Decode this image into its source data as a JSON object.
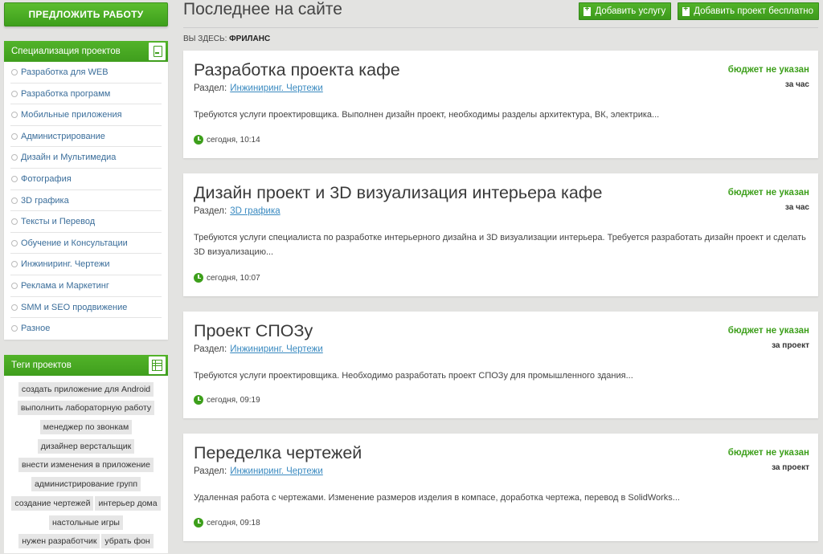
{
  "sidebar": {
    "offer_button": "ПРЕДЛОЖИТЬ РАБОТУ",
    "specs_title": "Специализация проектов",
    "specs": [
      "Разработка для WEB",
      "Разработка программ",
      "Мобильные приложения",
      "Администрирование",
      "Дизайн и Мультимедиа",
      "Фотография",
      "3D графика",
      "Тексты и Перевод",
      "Обучение и Консультации",
      "Инжиниринг. Чертежи",
      "Реклама и Маркетинг",
      "SMM и SEO продвижение",
      "Разное"
    ],
    "tags_title": "Теги проектов",
    "tags": [
      "создать приложение для Android",
      "выполнить лабораторную работу",
      "менеджер по звонкам",
      "дизайнер верстальщик",
      "внести изменения в приложение",
      "администрирование групп",
      "создание чертежей",
      "интерьер дома",
      "настольные игры",
      "нужен разработчик",
      "убрать фон"
    ]
  },
  "header": {
    "title": "Последнее на сайте",
    "add_service": "Добавить услугу",
    "add_project": "Добавить проект бесплатно",
    "crumbs_prefix": "ВЫ ЗДЕСЬ:",
    "crumbs_current": "ФРИЛАНС"
  },
  "projects": [
    {
      "title": "Разработка проекта кафе",
      "section_label": "Раздел:",
      "section": "Инжиниринг. Чертежи",
      "description": "Требуются услуги проектировщика. Выполнен дизайн проект, необходимы разделы архитектура, ВК, электрика...",
      "time": "сегодня, 10:14",
      "budget": "бюджет не указан",
      "per": "за час"
    },
    {
      "title": "Дизайн проект и 3D визуализация интерьера кафе",
      "section_label": "Раздел:",
      "section": "3D графика",
      "description": "Требуются услуги специалиста по разработке интерьерного дизайна и 3D визуализации интерьера. Требуется разработать дизайн проект и сделать 3D визуализацию...",
      "time": "сегодня, 10:07",
      "budget": "бюджет не указан",
      "per": "за час"
    },
    {
      "title": "Проект СПОЗу",
      "section_label": "Раздел:",
      "section": "Инжиниринг. Чертежи",
      "description": "Требуются услуги проектировщика. Необходимо разработать проект СПОЗу для промышленного здания...",
      "time": "сегодня, 09:19",
      "budget": "бюджет не указан",
      "per": "за проект"
    },
    {
      "title": "Переделка чертежей",
      "section_label": "Раздел:",
      "section": "Инжиниринг. Чертежи",
      "description": "Удаленная работа с чертежами. Изменение размеров изделия в компасе, доработка чертежа, перевод в SolidWorks...",
      "time": "сегодня, 09:18",
      "budget": "бюджет не указан",
      "per": "за проект"
    }
  ],
  "colors": {
    "accent_green": "#3d9f1b",
    "link_blue": "#3a8ac0",
    "background": "#e3e3e1"
  }
}
